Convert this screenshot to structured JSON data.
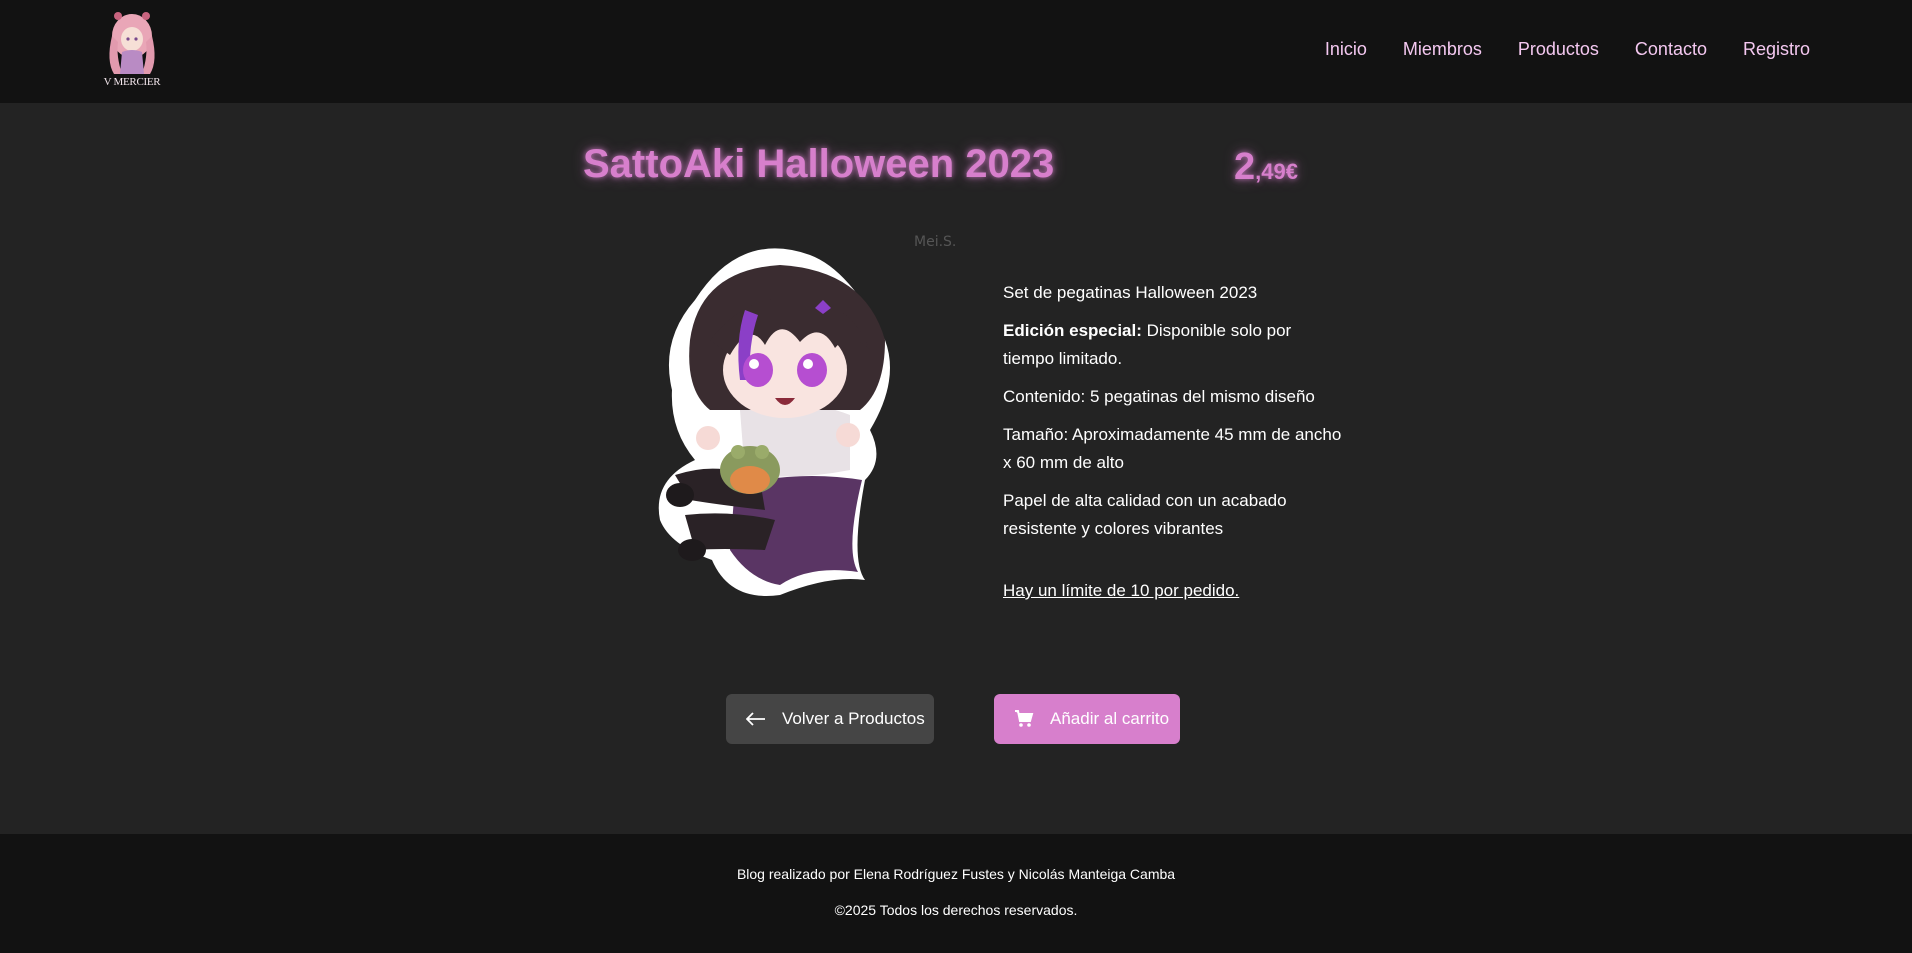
{
  "brand": {
    "logo_text": "V MERCIER"
  },
  "nav": {
    "items": [
      {
        "label": "Inicio"
      },
      {
        "label": "Miembros"
      },
      {
        "label": "Productos"
      },
      {
        "label": "Contacto"
      },
      {
        "label": "Registro"
      }
    ]
  },
  "product": {
    "title": "SattoAki Halloween 2023",
    "price_int": "2",
    "price_dec": ",49€",
    "artist_signature": "Mei.S.",
    "description": {
      "line1": "Set de pegatinas Halloween 2023",
      "special_label": "Edición especial:",
      "special_text": " Disponible solo por tiempo limitado.",
      "content": "Contenido: 5 pegatinas del mismo diseño",
      "size": "Tamaño: Aproximadamente 45 mm de ancho x 60 mm de alto",
      "paper": "Papel de alta calidad con un acabado resistente y colores vibrantes",
      "limit": "Hay un límite de 10 por pedido."
    }
  },
  "actions": {
    "back_label": "Volver a Productos",
    "cart_label": "Añadir al carrito"
  },
  "footer": {
    "credits": "Blog realizado por Elena Rodríguez Fustes y Nicolás Manteiga Camba",
    "copyright": "©2025 Todos los derechos reservados."
  },
  "colors": {
    "accent": "#d77fcc",
    "nav_link": "#f4c8f0",
    "background": "#232323",
    "header_footer": "#121212",
    "secondary_button": "#454545"
  },
  "icons": {
    "back": "arrow-left-icon",
    "cart": "cart-icon"
  }
}
